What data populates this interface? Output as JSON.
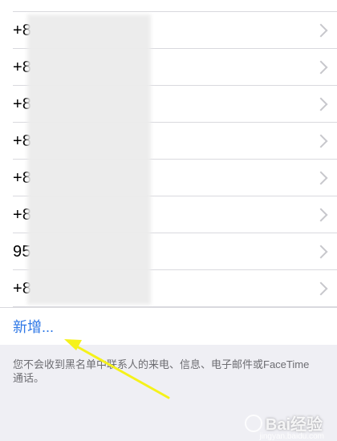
{
  "list": {
    "rows": [
      {
        "text": "+8"
      },
      {
        "text": "+8"
      },
      {
        "text": "+8"
      },
      {
        "text": "+8"
      },
      {
        "text": "+8"
      },
      {
        "text": "+8"
      },
      {
        "text": "95"
      },
      {
        "text": "+8"
      }
    ],
    "add_label": "新增..."
  },
  "footer": {
    "note": "您不会收到黑名单中联系人的来电、信息、电子邮件或FaceTime 通话。"
  },
  "watermark": {
    "text": "Bai经验",
    "sub": "jingyan.baidu.com"
  },
  "colors": {
    "link": "#2f78e6",
    "arrow": "#f5f21a"
  },
  "icons": {
    "chevron": "chevron-right-icon",
    "arrow": "arrow-annotation-icon"
  }
}
